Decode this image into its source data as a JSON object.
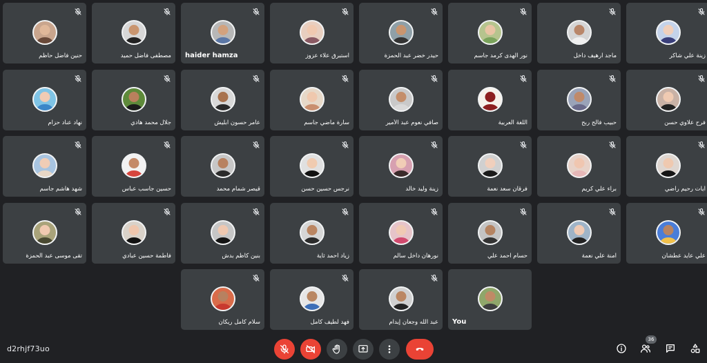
{
  "meeting": {
    "code": "d2rhjf73uo",
    "participant_count": "36"
  },
  "participants": [
    {
      "name": "حنين فاضل حاظم",
      "muted": true,
      "avatar_bg": "#c9a58d",
      "skin": "#e0b89a",
      "clothes": "#6a4a3a"
    },
    {
      "name": "مصطفى فاضل حميد",
      "muted": true,
      "avatar_bg": "#d7d7d7",
      "skin": "#c9956f",
      "clothes": "#222222"
    },
    {
      "name": "haider hamza",
      "muted": true,
      "avatar_bg": "#b7b7b7",
      "skin": "#d3a27e",
      "clothes": "#5b77a6"
    },
    {
      "name": "استبرق علاء عزوز",
      "muted": true,
      "avatar_bg": "#e8cfc0",
      "skin": "#f0c9b0",
      "clothes": "#8a5a64"
    },
    {
      "name": "حيدر خضر عبد الحمزة",
      "muted": true,
      "avatar_bg": "#8fa0a8",
      "skin": "#c9956f",
      "clothes": "#333333"
    },
    {
      "name": "نور الهدى كرمد جاسم",
      "muted": true,
      "avatar_bg": "#b6c48e",
      "skin": "#e9c4a4",
      "clothes": "#7aa35c"
    },
    {
      "name": "ماجد ارهيف داخل",
      "muted": true,
      "avatar_bg": "#d5d5d5",
      "skin": "#b9876a",
      "clothes": "#f0f0f0"
    },
    {
      "name": "زينة علي شاكر",
      "muted": true,
      "avatar_bg": "#c4d3ea",
      "skin": "#f0d0bc",
      "clothes": "#3a3f7a"
    },
    {
      "name": "نهاد عناد حزام",
      "muted": true,
      "avatar_bg": "#7fc4e6",
      "skin": "#f0cbb4",
      "clothes": "#3b86c8"
    },
    {
      "name": "جلال محمد هادي",
      "muted": true,
      "avatar_bg": "#5e8a3a",
      "skin": "#b9805d",
      "clothes": "#1c1c1c"
    },
    {
      "name": "عامر حسون ابليش",
      "muted": true,
      "avatar_bg": "#d8d8d8",
      "skin": "#a8724e",
      "clothes": "#2a2a2a"
    },
    {
      "name": "سارة ماضي جاسم",
      "muted": true,
      "avatar_bg": "#e6d8c8",
      "skin": "#efc8ae",
      "clothes": "#c98f6f"
    },
    {
      "name": "صافي نعوم عبد الأمير",
      "muted": true,
      "avatar_bg": "#c9c9c9",
      "skin": "#c48e6a",
      "clothes": "#d9d9d9"
    },
    {
      "name": "اللغة العربية",
      "muted": true,
      "avatar_bg": "#f6f2ea",
      "skin": "#8c1f1f",
      "clothes": "#8c1f1f"
    },
    {
      "name": "حبيب فالح ربح",
      "muted": true,
      "avatar_bg": "#9aa3b8",
      "skin": "#c08a6a",
      "clothes": "#6a6a8a"
    },
    {
      "name": "فرح علاوي حسن",
      "muted": true,
      "avatar_bg": "#c9b2a6",
      "skin": "#efcab2",
      "clothes": "#232323"
    },
    {
      "name": "شهد هاشم جاسم",
      "muted": true,
      "avatar_bg": "#a8c4e0",
      "skin": "#f0cdb6",
      "clothes": "#e8d7c6"
    },
    {
      "name": "حسين جاسب عباس",
      "muted": true,
      "avatar_bg": "#f2f2f2",
      "skin": "#c48a68",
      "clothes": "#d6453d"
    },
    {
      "name": "قيصر شمام محمد",
      "muted": true,
      "avatar_bg": "#c7c7c7",
      "skin": "#b88260",
      "clothes": "#2b2b2b"
    },
    {
      "name": "نرجس حسين حسن",
      "muted": true,
      "avatar_bg": "#e0e0e0",
      "skin": "#f0cbb0",
      "clothes": "#111111"
    },
    {
      "name": "زينة وليد خالد",
      "muted": true,
      "avatar_bg": "#d7a0b0",
      "skin": "#f1cdb6",
      "clothes": "#3a2a2a"
    },
    {
      "name": "فرقان سعد نعمة",
      "muted": true,
      "avatar_bg": "#d0d0d0",
      "skin": "#f0cfbc",
      "clothes": "#1a1a1a"
    },
    {
      "name": "براء علي كريم",
      "muted": true,
      "avatar_bg": "#e8d2c8",
      "skin": "#f0c6b0",
      "clothes": "#e6b7b7"
    },
    {
      "name": "آيات رحيم راضي",
      "muted": true,
      "avatar_bg": "#ded6d0",
      "skin": "#efc9b0",
      "clothes": "#151515"
    },
    {
      "name": "تقى موسى عبد الحمزة",
      "muted": true,
      "avatar_bg": "#a9a37a",
      "skin": "#f0c9b0",
      "clothes": "#4a4a32"
    },
    {
      "name": "فاطمة حسين عبادي",
      "muted": true,
      "avatar_bg": "#d9d2c9",
      "skin": "#efc6ad",
      "clothes": "#121212"
    },
    {
      "name": "بنين كاظم بدش",
      "muted": true,
      "avatar_bg": "#c6c6c6",
      "skin": "#efc8b0",
      "clothes": "#141414"
    },
    {
      "name": "زياد احمد ثاية",
      "muted": true,
      "avatar_bg": "#d6d6d6",
      "skin": "#bb8662",
      "clothes": "#2b2b2b"
    },
    {
      "name": "نورهان داخل سالم",
      "muted": true,
      "avatar_bg": "#e6c4c9",
      "skin": "#f0cab4",
      "clothes": "#d14a6e"
    },
    {
      "name": "حسام احمد علي",
      "muted": true,
      "avatar_bg": "#c4c4c4",
      "skin": "#b58462",
      "clothes": "#333333"
    },
    {
      "name": "آمنة علي نعمة",
      "muted": true,
      "avatar_bg": "#9fb4c8",
      "skin": "#f0cab4",
      "clothes": "#222222"
    },
    {
      "name": "علي عايد عطشان",
      "muted": true,
      "avatar_bg": "#4a7dd8",
      "skin": "#b88462",
      "clothes": "#f2c14a"
    },
    {
      "name": "سلام كامل ريكان",
      "muted": true,
      "avatar_bg": "#d96c4a",
      "skin": "#b78160",
      "clothes": "#c83a2f"
    },
    {
      "name": "فهد لطيف كامل",
      "muted": true,
      "avatar_bg": "#e6e6e6",
      "skin": "#b98763",
      "clothes": "#3d6fb8"
    },
    {
      "name": "عبد الله وجعان إيدام",
      "muted": true,
      "avatar_bg": "#d0d0d0",
      "skin": "#bb8763",
      "clothes": "#242424"
    },
    {
      "name": "You",
      "muted": false,
      "avatar_bg": "#8fa66a",
      "skin": "#c08a66",
      "clothes": "#3f3f3f"
    }
  ],
  "controls": {
    "mic": {
      "icon": "mic-off-icon",
      "state": "off"
    },
    "camera": {
      "icon": "camera-off-icon",
      "state": "off"
    },
    "raise_hand": {
      "icon": "hand-icon"
    },
    "present": {
      "icon": "present-screen-icon"
    },
    "more": {
      "icon": "more-vert-icon"
    },
    "leave": {
      "icon": "call-end-icon"
    }
  },
  "right_panel_icons": [
    "info-icon",
    "people-icon",
    "chat-icon",
    "activities-icon"
  ],
  "colors": {
    "background": "#202124",
    "tile": "#3c4043",
    "danger": "#ea4335"
  }
}
